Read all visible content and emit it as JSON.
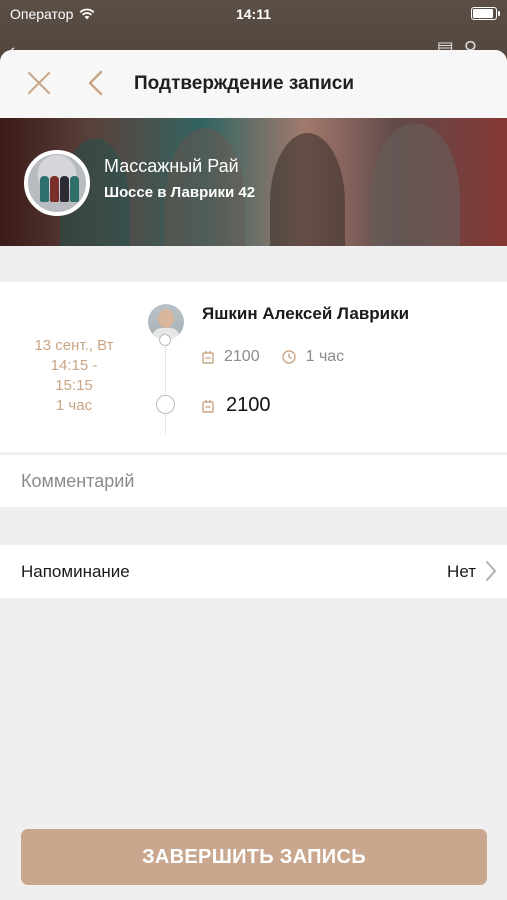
{
  "status_bar": {
    "carrier": "Оператор",
    "time": "14:11"
  },
  "header": {
    "title": "Подтверждение записи"
  },
  "salon": {
    "name": "Массажный Рай",
    "address": "Шоссе в Лаврики 42"
  },
  "booking": {
    "date": "13 сент., Вт",
    "time_range_start": "14:15 -",
    "time_range_end": "15:15",
    "duration": "1 час",
    "master_name": "Яшкин Алексей Лаврики",
    "service_price": "2100",
    "service_duration": "1 час",
    "total_price": "2100"
  },
  "comment": {
    "placeholder": "Комментарий"
  },
  "reminder": {
    "label": "Напоминание",
    "value": "Нет"
  },
  "submit": {
    "label": "ЗАВЕРШИТЬ ЗАПИСЬ"
  },
  "colors": {
    "accent": "#c8a78e",
    "date_text": "#c9a585",
    "sheet_bg": "#efefef"
  }
}
